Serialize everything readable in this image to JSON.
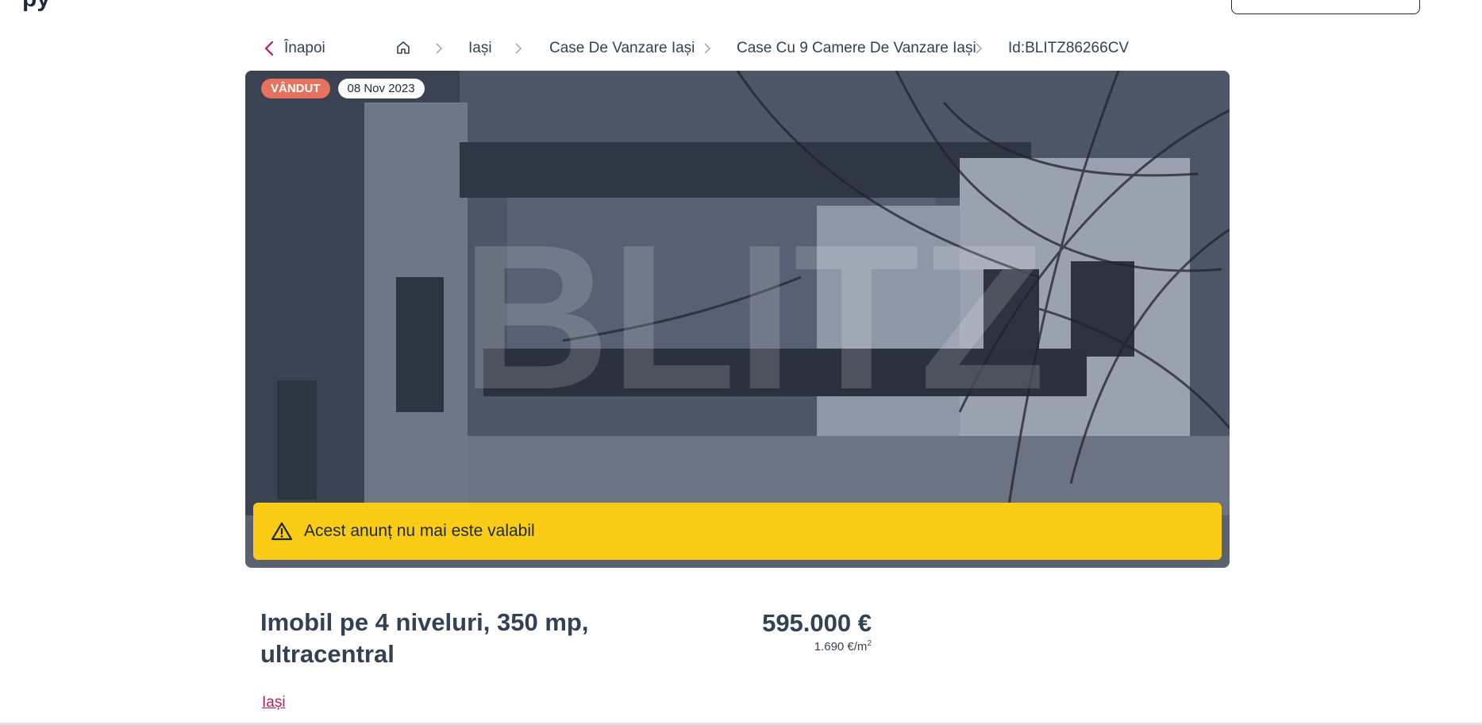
{
  "header": {
    "logo_fragment": "py"
  },
  "breadcrumb": {
    "back_label": "Înapoi",
    "items": [
      "Iași",
      "Case De Vanzare Iași",
      "Case Cu 9 Camere De Vanzare Iași",
      "Id:BLITZ86266CV"
    ]
  },
  "listing": {
    "status_badge": "VÂNDUT",
    "date_badge": "08 Nov 2023",
    "watermark": "BLITZ",
    "notice": "Acest anunț nu mai este valabil",
    "title": "Imobil pe 4 niveluri, 350 mp, ultracentral",
    "price": "595.000 €",
    "price_per_sqm": "1.690 €/m",
    "price_per_sqm_sup": "2",
    "city": "Iași"
  },
  "colors": {
    "accent": "#be185d",
    "sold": "#e5725f",
    "notice_bg": "#facc15"
  }
}
